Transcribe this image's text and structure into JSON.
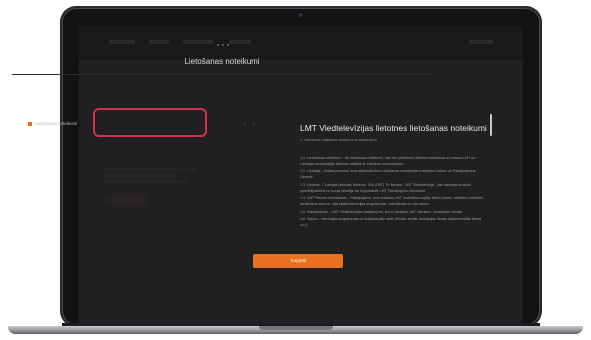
{
  "modal": {
    "title": "Lietošanas noteikumi",
    "tab_label": "Lietošanas noteikumi",
    "prev_icon": "chevron-left-icon",
    "next_icon": "chevron-right-icon"
  },
  "document": {
    "title": "LMT Viedtelevīzijas lietotnes lietošanas noteikumi",
    "subtitle": "1. Lietošanas noteikumu termini un to skaidrojumi",
    "paragraphs": [
      "1.1. Lietošanas noteikumi – šie lietošanas noteikumi, kas tiek piemēroti Lietotnes lietošanai un nosaka LMT un Lietotāja savstarpējās tiesības saistībā ar Lietotnes izmantošanu.",
      "1.2. Lietotājs – fiziska persona, kura atbilstoši šiem Lietošanas noteikumiem izmanto Lietotni un Pakalpojumus Lietotnē.",
      "1.3. Lietotne – \"Latvijas Mobilais Telefons\" SIA (LMT) TV lietotne \"LMT Viedtelevīzija\", kas darbojas Android operētājsistēmā un kuras lietotājs var lejupielādēt LMT Pakalpojumu lietošanai.",
      "1.4. LMT Pieņem vienošanos – Pakalpojums, kura ietvaros LMT nodrošina iespēju lietot Lietotni, skatīties Lietotnes piedāvātos saturus, tajā skaitā televīzijas programmas, videofilmas un citu saturu.",
      "1.5. Pakalpojums – LMT Viedtelevīzijas pakalpojumi, kuri ir pieejami LMT klientiem, izmantojot Lietotni.",
      "1.6. Saturs – televīzijas programmas un audiovizuālie darbi (filmas, seriāli, animācijas filmas, dokumentālās filmas u.c.)."
    ]
  },
  "buttons": {
    "accept_label": "Turpināt"
  },
  "colors": {
    "accent": "#e9711f",
    "highlight": "#d2314a",
    "screen_background": "#1c1c1f"
  }
}
